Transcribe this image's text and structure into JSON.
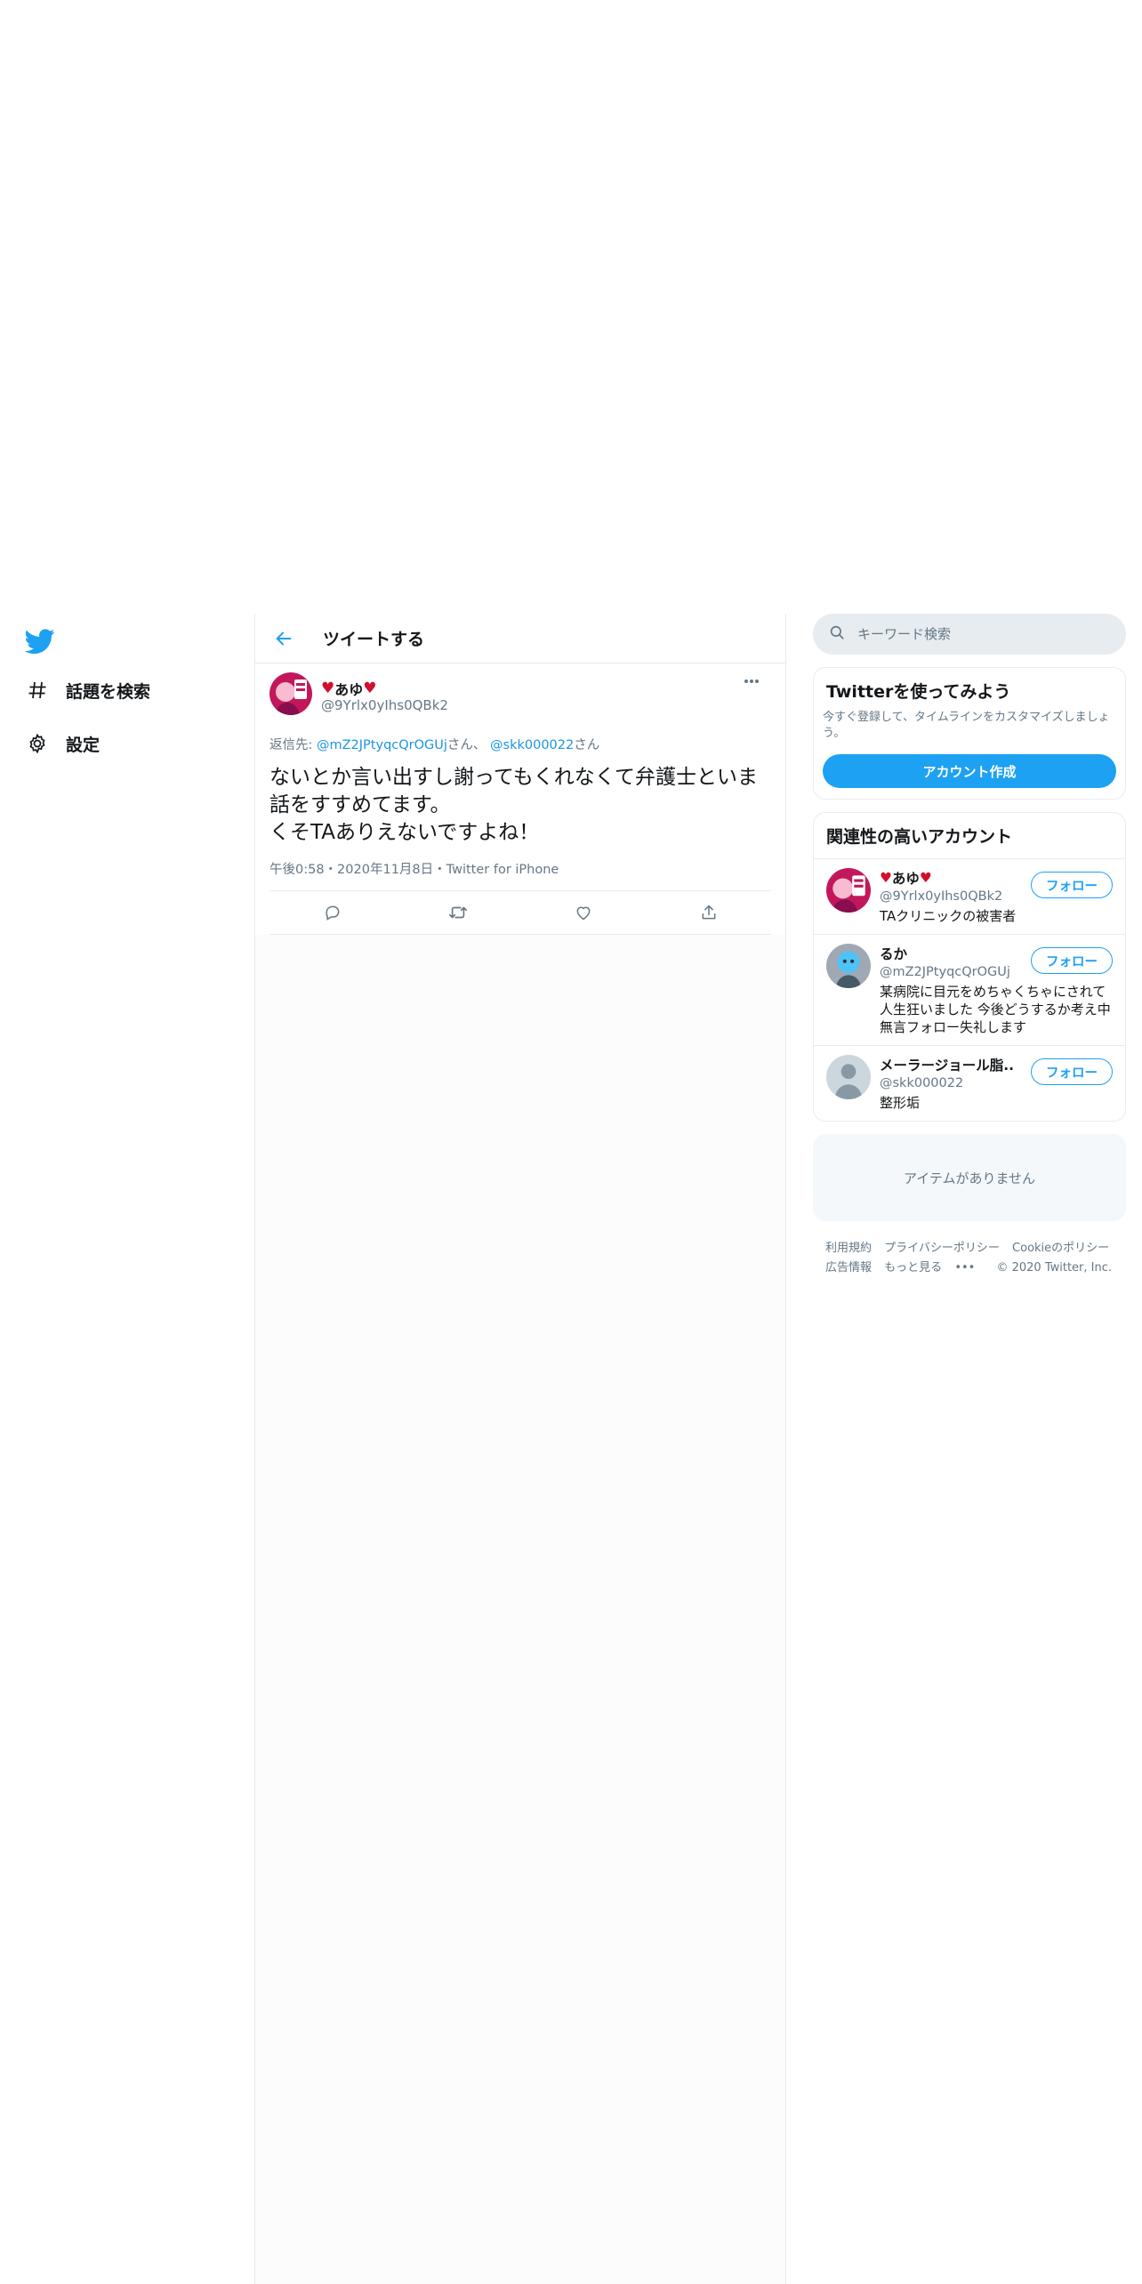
{
  "nav": {
    "items": [
      {
        "label": "話題を検索",
        "icon": "hashtag-icon"
      },
      {
        "label": "設定",
        "icon": "gear-icon"
      }
    ]
  },
  "header": {
    "title": "ツイートする"
  },
  "tweet": {
    "author_name": "あゆ",
    "author_handle": "@9Yrlx0yIhs0QBk2",
    "reply_prefix": "返信先: ",
    "reply_mention_1": "@mZ2JPtyqcQrOGUj",
    "reply_suffix_1": "さん、",
    "reply_mention_2": "@skk000022",
    "reply_suffix_2": "さん",
    "text": "ないとか言い出すし謝ってもくれなくて弁護士といま話をすすめてます。\nくそTAありえないですよね！",
    "meta": "午後0:58・2020年11月8日・Twitter for iPhone"
  },
  "search": {
    "placeholder": "キーワード検索"
  },
  "signup_card": {
    "title": "Twitterを使ってみよう",
    "description": "今すぐ登録して、タイムラインをカスタマイズしましょう。",
    "button_label": "アカウント作成"
  },
  "related": {
    "title": "関連性の高いアカウント",
    "follow_label": "フォロー",
    "accounts": [
      {
        "name": "あゆ",
        "handle": "@9Yrlx0yIhs0QBk2",
        "bio": "TAクリニックの被害者"
      },
      {
        "name": "るか",
        "handle": "@mZ2JPtyqcQrOGUj",
        "bio": "某病院に目元をめちゃくちゃにされて人生狂いました 今後どうするか考え中 無言フォロー失礼します"
      },
      {
        "name": "メーラージョール脂...",
        "handle": "@skk000022",
        "bio": "整形垢"
      }
    ]
  },
  "empty_card": {
    "text": "アイテムがありません"
  },
  "footer": {
    "terms": "利用規約",
    "privacy": "プライバシーポリシー",
    "cookie": "Cookieのポリシー",
    "ads": "広告情報",
    "more": "もっと見る",
    "copyright": "© 2020 Twitter, Inc."
  },
  "colors": {
    "accent": "#1da1f2",
    "heart": "#d0102c",
    "muted": "#657786"
  }
}
